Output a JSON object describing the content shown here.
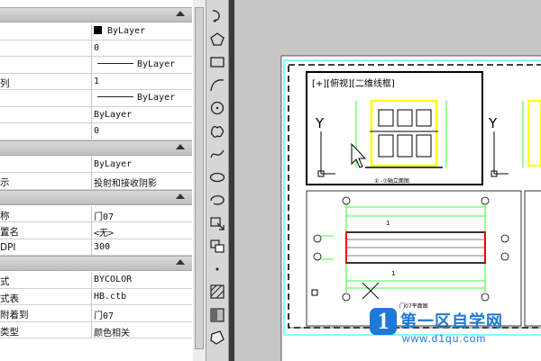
{
  "properties": {
    "sections": [
      {
        "rows": [
          {
            "key": "",
            "value": "ByLayer",
            "kind": "swatch"
          },
          {
            "key": "",
            "value": "0",
            "kind": "text"
          },
          {
            "key": "",
            "value": "ByLayer",
            "kind": "line"
          },
          {
            "key": "列",
            "value": "1",
            "kind": "text"
          },
          {
            "key": "",
            "value": "ByLayer",
            "kind": "line"
          },
          {
            "key": "",
            "value": "ByLayer",
            "kind": "text"
          },
          {
            "key": "",
            "value": "0",
            "kind": "text"
          }
        ]
      },
      {
        "rows": [
          {
            "key": "",
            "value": "ByLayer",
            "kind": "text"
          },
          {
            "key": "示",
            "value": "投射和接收阴影",
            "kind": "text"
          }
        ]
      },
      {
        "rows": [
          {
            "key": "称",
            "value": "门07",
            "kind": "text"
          },
          {
            "key": "置名",
            "value": "<无>",
            "kind": "text"
          },
          {
            "key": "DPI",
            "value": "300",
            "kind": "text"
          }
        ]
      },
      {
        "rows": [
          {
            "key": "式",
            "value": "BYCOLOR",
            "kind": "text"
          },
          {
            "key": "式表",
            "value": "HB.ctb",
            "kind": "text"
          },
          {
            "key": "附着到",
            "value": "门07",
            "kind": "text"
          },
          {
            "key": "类型",
            "value": "颜色相关",
            "kind": "text"
          }
        ]
      }
    ]
  },
  "toolbar": {
    "icons": [
      "rotate-arc-icon",
      "polygon-icon",
      "rectangle-icon",
      "arc-icon",
      "circle-icon",
      "revision-cloud-icon",
      "spline-icon",
      "ellipse-icon",
      "ellipse-arc-icon",
      "insert-block-icon",
      "make-block-icon",
      "point-icon",
      "hatch-icon",
      "gradient-icon",
      "region-icon"
    ]
  },
  "drawing": {
    "viewport_label": "[+][俯视][二维线框]",
    "axis_label": "Y",
    "front_caption": "① -⑦轴立面图",
    "plan_caption": "门07平面图",
    "dim_mark": "1"
  },
  "watermark": {
    "name": "第一区自学网",
    "url": "www.d1qu.com",
    "logo_letter": "1"
  },
  "colors": {
    "cad_white": "#ffffff",
    "cad_cyan": "#00ffff",
    "cad_yellow": "#ffff00",
    "cad_green": "#00ff00",
    "cad_red": "#ff0000",
    "brand_blue": "#1e78d7"
  }
}
